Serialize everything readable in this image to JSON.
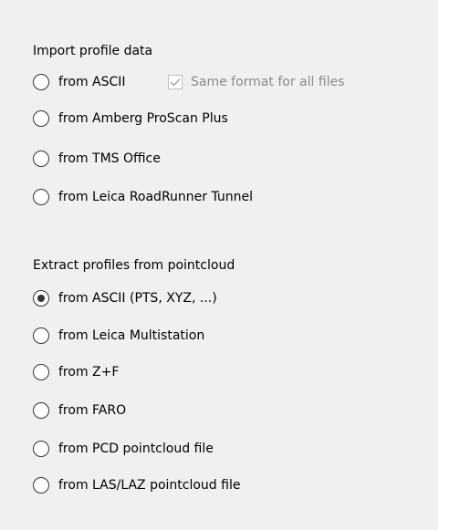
{
  "import_group": {
    "label": "Import profile data",
    "options": [
      {
        "label": "from ASCII",
        "selected": false
      },
      {
        "label": "from Amberg ProScan Plus",
        "selected": false
      },
      {
        "label": "from TMS Office",
        "selected": false
      },
      {
        "label": "from Leica RoadRunner Tunnel",
        "selected": false
      }
    ],
    "same_format_checkbox": {
      "label": "Same format for all files",
      "checked": true,
      "disabled": true
    }
  },
  "extract_group": {
    "label": "Extract profiles from pointcloud",
    "options": [
      {
        "label": "from ASCII (PTS, XYZ, ...)",
        "selected": true
      },
      {
        "label": "from Leica Multistation",
        "selected": false
      },
      {
        "label": "from Z+F",
        "selected": false
      },
      {
        "label": "from FARO",
        "selected": false
      },
      {
        "label": "from PCD pointcloud file",
        "selected": false
      },
      {
        "label": "from LAS/LAZ pointcloud file",
        "selected": false
      }
    ]
  },
  "colors": {
    "panel_background": "#f0f0f0",
    "radio_border": "#333333",
    "disabled_text": "#8a8a8a",
    "checkmark": "#a9a9a9"
  }
}
